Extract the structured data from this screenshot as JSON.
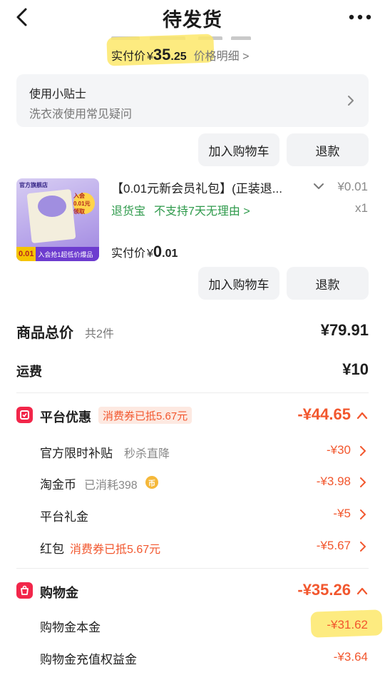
{
  "header": {
    "title": "待发货",
    "back_icon": "back-arrow-icon",
    "more_icon": "more-dots-icon"
  },
  "first_item": {
    "paid_label": "实付价",
    "currency": "¥",
    "amount_int": "35",
    "amount_dec": ".25",
    "price_detail_label": "价格明细 >"
  },
  "tips": {
    "title": "使用小贴士",
    "subtitle": "洗衣液使用常见疑问"
  },
  "buttons": {
    "add_to_cart": "加入购物车",
    "refund": "退款"
  },
  "product": {
    "title": "【0.01元新会员礼包】(正装退...",
    "price": "¥0.01",
    "return_guarantee": "退货宝",
    "no_return_note": "不支持7天无理由 >",
    "quantity": "x1",
    "paid_label": "实付价",
    "currency": "¥",
    "amount_int": "0",
    "amount_dec": ".01",
    "image": {
      "store_label": "官方旗舰店",
      "badge_text": "入会0.01元领取",
      "price_tag": "0.01",
      "banner_text": "入会抢1超低价爆品"
    }
  },
  "summary": {
    "total_label": "商品总价",
    "total_count": "共2件",
    "total_amount": "¥79.91",
    "shipping_label": "运费",
    "shipping_amount": "¥10"
  },
  "platform_discount": {
    "title": "平台优惠",
    "coupon_tag": "消费券已抵5.67元",
    "amount": "-¥44.65",
    "items": [
      {
        "label": "官方限时补贴",
        "sub": "秒杀直降",
        "amount": "-¥30"
      },
      {
        "label": "淘金币",
        "sub": "已消耗398",
        "amount": "-¥3.98"
      },
      {
        "label": "平台礼金",
        "sub": "",
        "amount": "-¥5"
      },
      {
        "label": "红包",
        "tag": "消费券已抵5.67元",
        "amount": "-¥5.67"
      }
    ]
  },
  "shopping_gold": {
    "title": "购物金",
    "amount": "-¥35.26",
    "items": [
      {
        "label": "购物金本金",
        "amount": "-¥31.62"
      },
      {
        "label": "购物金充值权益金",
        "amount": "-¥3.64"
      }
    ]
  },
  "colors": {
    "accent_orange": "#f2572e",
    "brand_red": "#f2264a",
    "green": "#2e9a4b",
    "highlight": "#fde76a"
  }
}
